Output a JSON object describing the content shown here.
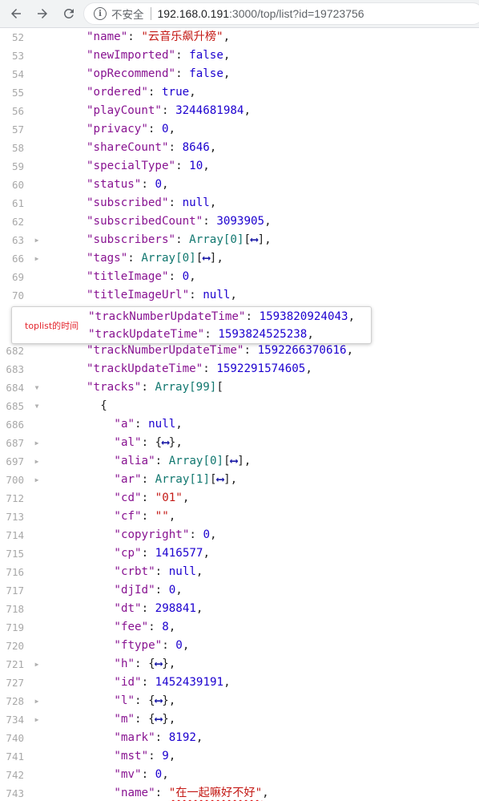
{
  "browser": {
    "security_label": "不安全",
    "url_host": "192.168.0.191",
    "url_rest": ":3000/top/list?id=19723756",
    "back_icon": "arrow-left-icon",
    "forward_icon": "arrow-right-icon",
    "reload_icon": "reload-icon",
    "info_icon": "info-icon"
  },
  "annotation": {
    "label": "toplist的时间"
  },
  "code_lines": [
    {
      "ln": "52",
      "indent": 6,
      "key": "name",
      "val": "\"云音乐飙升榜\"",
      "vt": "s"
    },
    {
      "ln": "53",
      "indent": 6,
      "key": "newImported",
      "val": "false",
      "vt": "kw"
    },
    {
      "ln": "54",
      "indent": 6,
      "key": "opRecommend",
      "val": "false",
      "vt": "kw"
    },
    {
      "ln": "55",
      "indent": 6,
      "key": "ordered",
      "val": "true",
      "vt": "kw"
    },
    {
      "ln": "56",
      "indent": 6,
      "key": "playCount",
      "val": "3244681984",
      "vt": "n"
    },
    {
      "ln": "57",
      "indent": 6,
      "key": "privacy",
      "val": "0",
      "vt": "n"
    },
    {
      "ln": "58",
      "indent": 6,
      "key": "shareCount",
      "val": "8646",
      "vt": "n"
    },
    {
      "ln": "59",
      "indent": 6,
      "key": "specialType",
      "val": "10",
      "vt": "n"
    },
    {
      "ln": "60",
      "indent": 6,
      "key": "status",
      "val": "0",
      "vt": "n"
    },
    {
      "ln": "61",
      "indent": 6,
      "key": "subscribed",
      "val": "null",
      "vt": "kw"
    },
    {
      "ln": "62",
      "indent": 6,
      "key": "subscribedCount",
      "val": "3093905",
      "vt": "n"
    },
    {
      "ln": "63",
      "indent": 6,
      "key": "subscribers",
      "val": "Array[0]",
      "vt": "ty",
      "exp": "[⟷]",
      "arrow": "right"
    },
    {
      "ln": "66",
      "indent": 6,
      "key": "tags",
      "val": "Array[0]",
      "vt": "ty",
      "exp": "[⟷]",
      "arrow": "right"
    },
    {
      "ln": "69",
      "indent": 6,
      "key": "titleImage",
      "val": "0",
      "vt": "n"
    },
    {
      "ln": "70",
      "indent": 6,
      "key": "titleImageUrl",
      "val": "null",
      "vt": "kw"
    },
    {
      "ln": "71",
      "indent": 6,
      "key": "trackNumberUpdateTime",
      "val": "1593820924043",
      "vt": "n",
      "hidden": true
    },
    {
      "ln": "72",
      "indent": 6,
      "key": "trackUpdateTime",
      "val": "1593824525238",
      "vt": "n",
      "hidden": true
    },
    {
      "ln": "682",
      "indent": 6,
      "key": "trackNumberUpdateTime",
      "val": "1592266370616",
      "vt": "n"
    },
    {
      "ln": "683",
      "indent": 6,
      "key": "trackUpdateTime",
      "val": "1592291574605",
      "vt": "n"
    },
    {
      "ln": "684",
      "indent": 6,
      "key": "tracks",
      "val": "Array[99]",
      "vt": "ty",
      "raw_tail": "[",
      "arrow": "down",
      "nocomma": true
    },
    {
      "ln": "685",
      "indent": 8,
      "raw": "{",
      "arrow": "down"
    },
    {
      "ln": "686",
      "indent": 10,
      "key": "a",
      "val": "null",
      "vt": "kw"
    },
    {
      "ln": "687",
      "indent": 10,
      "key": "al",
      "val": "",
      "vt": "p",
      "obj": true,
      "arrow": "right"
    },
    {
      "ln": "697",
      "indent": 10,
      "key": "alia",
      "val": "Array[0]",
      "vt": "ty",
      "exp": "[⟷]",
      "arrow": "right"
    },
    {
      "ln": "700",
      "indent": 10,
      "key": "ar",
      "val": "Array[1]",
      "vt": "ty",
      "exp": "[⟷]",
      "arrow": "right"
    },
    {
      "ln": "712",
      "indent": 10,
      "key": "cd",
      "val": "\"01\"",
      "vt": "s"
    },
    {
      "ln": "713",
      "indent": 10,
      "key": "cf",
      "val": "\"\"",
      "vt": "s"
    },
    {
      "ln": "714",
      "indent": 10,
      "key": "copyright",
      "val": "0",
      "vt": "n"
    },
    {
      "ln": "715",
      "indent": 10,
      "key": "cp",
      "val": "1416577",
      "vt": "n"
    },
    {
      "ln": "716",
      "indent": 10,
      "key": "crbt",
      "val": "null",
      "vt": "kw"
    },
    {
      "ln": "717",
      "indent": 10,
      "key": "djId",
      "val": "0",
      "vt": "n"
    },
    {
      "ln": "718",
      "indent": 10,
      "key": "dt",
      "val": "298841",
      "vt": "n"
    },
    {
      "ln": "719",
      "indent": 10,
      "key": "fee",
      "val": "8",
      "vt": "n"
    },
    {
      "ln": "720",
      "indent": 10,
      "key": "ftype",
      "val": "0",
      "vt": "n"
    },
    {
      "ln": "721",
      "indent": 10,
      "key": "h",
      "val": "",
      "vt": "p",
      "obj": true,
      "arrow": "right"
    },
    {
      "ln": "727",
      "indent": 10,
      "key": "id",
      "val": "1452439191",
      "vt": "n"
    },
    {
      "ln": "728",
      "indent": 10,
      "key": "l",
      "val": "",
      "vt": "p",
      "obj": true,
      "arrow": "right"
    },
    {
      "ln": "734",
      "indent": 10,
      "key": "m",
      "val": "",
      "vt": "p",
      "obj": true,
      "arrow": "right"
    },
    {
      "ln": "740",
      "indent": 10,
      "key": "mark",
      "val": "8192",
      "vt": "n"
    },
    {
      "ln": "741",
      "indent": 10,
      "key": "mst",
      "val": "9",
      "vt": "n"
    },
    {
      "ln": "742",
      "indent": 10,
      "key": "mv",
      "val": "0",
      "vt": "n"
    },
    {
      "ln": "743",
      "indent": 10,
      "key": "name",
      "val": "\"在一起嘛好不好\"",
      "vt": "s",
      "underline": true
    }
  ]
}
